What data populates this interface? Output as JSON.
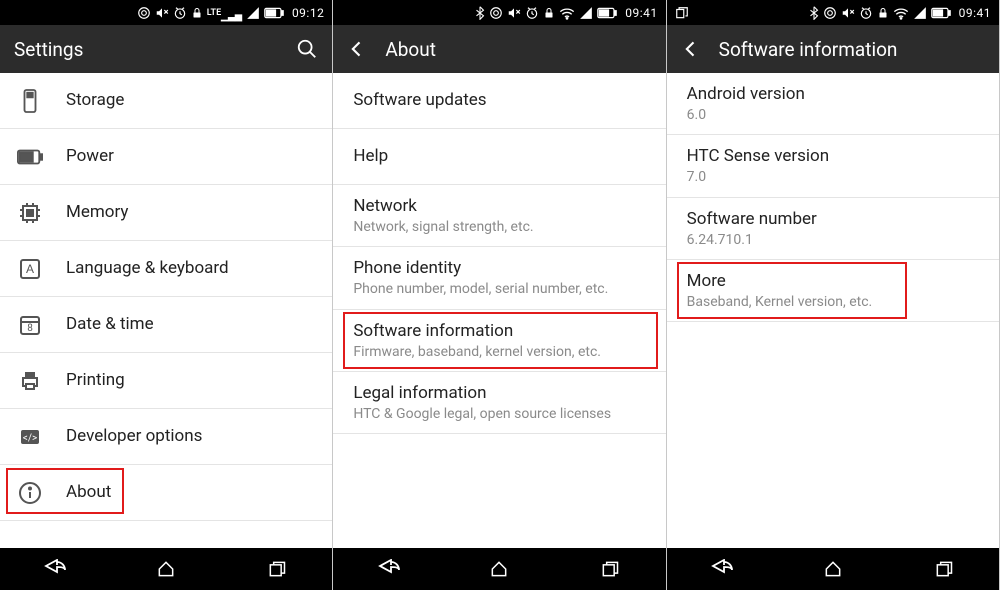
{
  "screen1": {
    "status": {
      "clock": "09:12",
      "lte": "LTE"
    },
    "header": {
      "title": "Settings"
    },
    "items": [
      {
        "label": "Storage"
      },
      {
        "label": "Power"
      },
      {
        "label": "Memory"
      },
      {
        "label": "Language & keyboard"
      },
      {
        "label": "Date & time"
      },
      {
        "label": "Printing"
      },
      {
        "label": "Developer options"
      },
      {
        "label": "About"
      }
    ]
  },
  "screen2": {
    "status": {
      "clock": "09:41"
    },
    "header": {
      "title": "About"
    },
    "items": [
      {
        "label": "Software updates",
        "sub": ""
      },
      {
        "label": "Help",
        "sub": ""
      },
      {
        "label": "Network",
        "sub": "Network, signal strength, etc."
      },
      {
        "label": "Phone identity",
        "sub": "Phone number, model, serial number, etc."
      },
      {
        "label": "Software information",
        "sub": "Firmware, baseband, kernel version, etc."
      },
      {
        "label": "Legal information",
        "sub": "HTC & Google legal, open source licenses"
      }
    ]
  },
  "screen3": {
    "status": {
      "clock": "09:41"
    },
    "header": {
      "title": "Software information"
    },
    "items": [
      {
        "label": "Android version",
        "sub": "6.0"
      },
      {
        "label": "HTC Sense version",
        "sub": "7.0"
      },
      {
        "label": "Software number",
        "sub": "6.24.710.1"
      },
      {
        "label": "More",
        "sub": "Baseband, Kernel version, etc."
      }
    ]
  }
}
